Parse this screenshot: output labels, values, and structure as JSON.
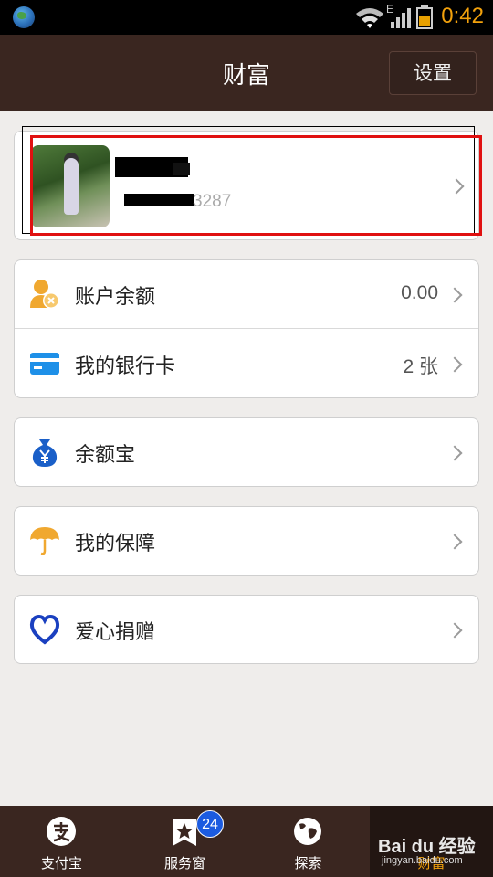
{
  "status_bar": {
    "time": "0:42",
    "network_type": "E"
  },
  "header": {
    "title": "财富",
    "settings_label": "设置"
  },
  "profile": {
    "phone_suffix": "3287"
  },
  "card1": {
    "rows": [
      {
        "label": "账户余额",
        "value": "0.00",
        "icon": "user-coin-icon"
      },
      {
        "label": "我的银行卡",
        "value": "2 张",
        "icon": "bank-card-icon"
      }
    ]
  },
  "card2": {
    "label": "余额宝",
    "icon": "money-bag-icon"
  },
  "card3": {
    "label": "我的保障",
    "icon": "umbrella-icon"
  },
  "card4": {
    "label": "爱心捐赠",
    "icon": "heart-icon"
  },
  "bottom_nav": {
    "tabs": [
      {
        "label": "支付宝",
        "icon": "alipay-icon"
      },
      {
        "label": "服务窗",
        "icon": "star-window-icon",
        "badge": "24"
      },
      {
        "label": "探索",
        "icon": "globe-icon"
      },
      {
        "label": "财富",
        "icon": "wealth-icon"
      }
    ]
  },
  "watermark": {
    "line1": "Bai du 经验",
    "line2": "jingyan.baidu.com"
  },
  "colors": {
    "header_bg": "#3a2620",
    "accent_orange": "#f2a10c",
    "badge_blue": "#1b5be0",
    "card_blue": "#1e90e8"
  }
}
